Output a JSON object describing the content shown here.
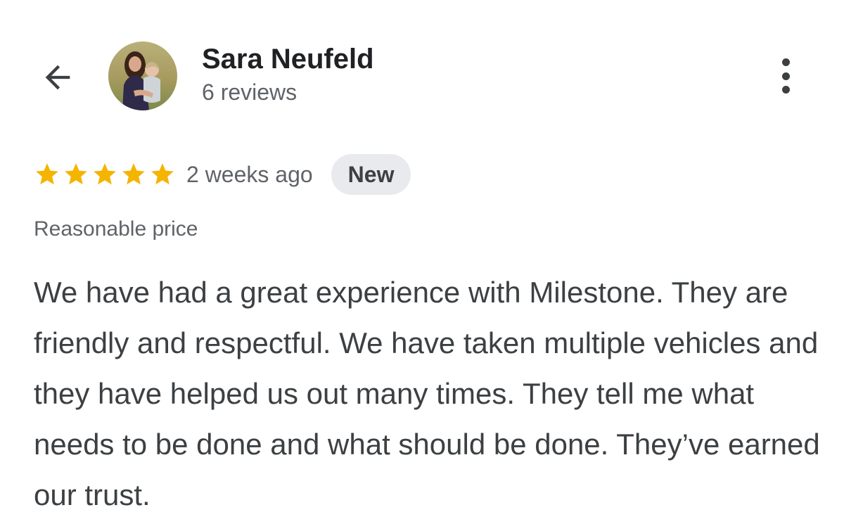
{
  "header": {
    "back_icon": "arrow-back-icon",
    "reviewer_name": "Sara Neufeld",
    "review_count": "6 reviews",
    "more_icon": "more-vertical-icon"
  },
  "review": {
    "rating": 5,
    "rating_max": 5,
    "star_color": "#f4b400",
    "time_ago": "2 weeks ago",
    "badge": "New",
    "tag": "Reasonable price",
    "text": "We have had a great experience with Milestone. They are friendly and respectful. We have taken multiple vehicles and they have helped us out many times. They tell me what needs to be done and what should be done. They’ve earned our trust."
  }
}
